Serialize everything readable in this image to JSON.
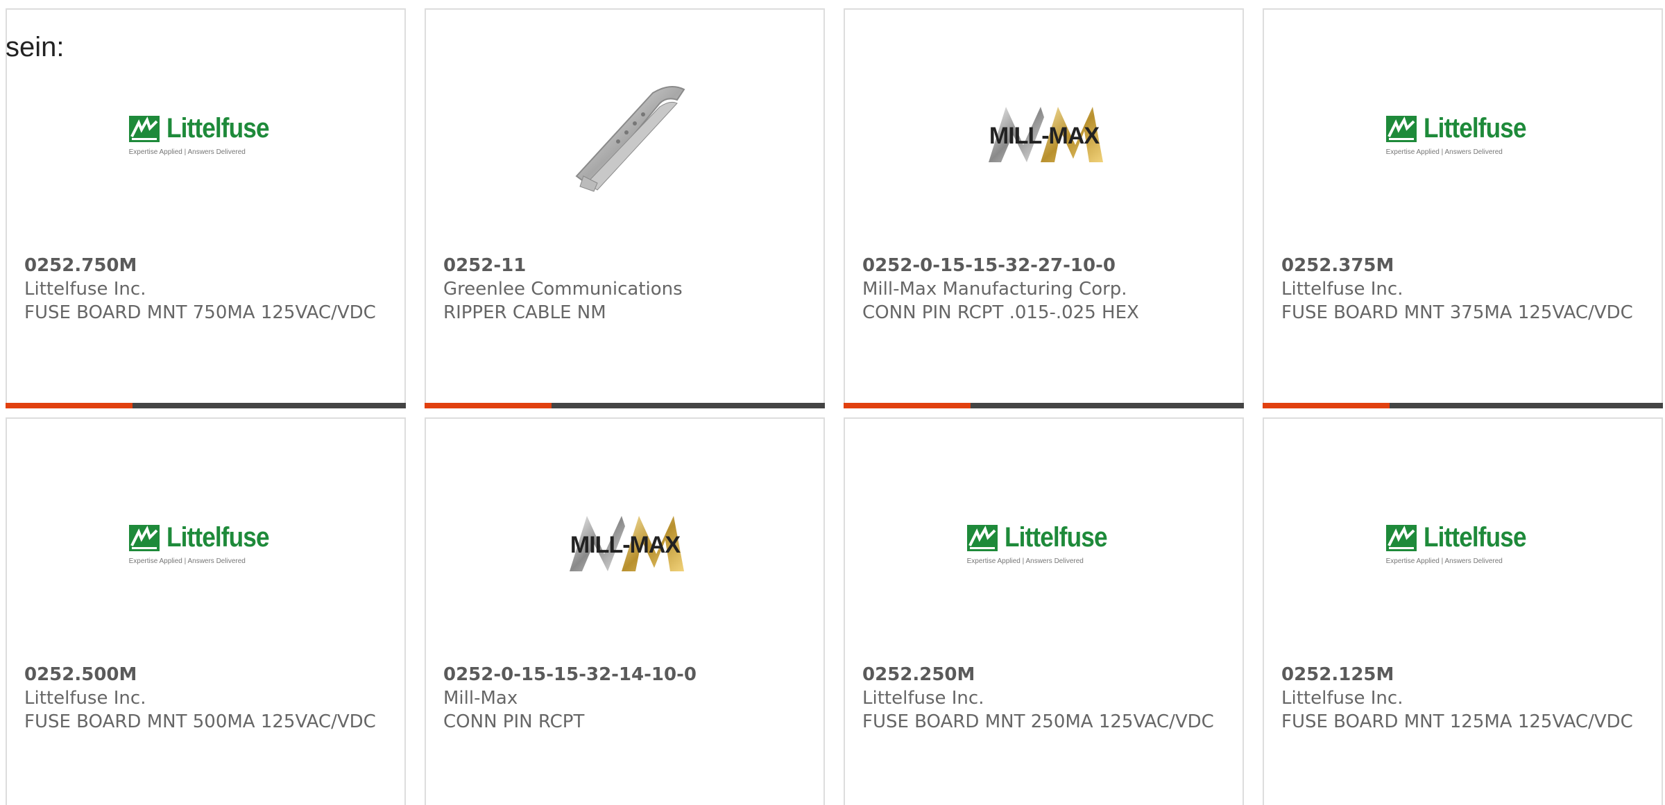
{
  "intro_text": "sein:",
  "colors": {
    "accent": "#e1400f",
    "bar": "#444444",
    "littelfuse_green": "#1e8a3a"
  },
  "logo_text": {
    "littelfuse_name": "Littelfuse",
    "littelfuse_tagline": "Expertise Applied | Answers Delivered",
    "millmax_name": "MILL-MAX"
  },
  "products": [
    {
      "part_number": "0252.750M",
      "manufacturer": "Littelfuse Inc.",
      "description": "FUSE BOARD MNT 750MA 125VAC/VDC",
      "image": "littelfuse-logo"
    },
    {
      "part_number": "0252-11",
      "manufacturer": "Greenlee Communications",
      "description": "RIPPER CABLE NM",
      "image": "cable-ripper-tool"
    },
    {
      "part_number": "0252-0-15-15-32-27-10-0",
      "manufacturer": "Mill-Max Manufacturing Corp.",
      "description": "CONN PIN RCPT .015-.025 HEX",
      "image": "millmax-logo"
    },
    {
      "part_number": "0252.375M",
      "manufacturer": "Littelfuse Inc.",
      "description": "FUSE BOARD MNT 375MA 125VAC/VDC",
      "image": "littelfuse-logo"
    },
    {
      "part_number": "0252.500M",
      "manufacturer": "Littelfuse Inc.",
      "description": "FUSE BOARD MNT 500MA 125VAC/VDC",
      "image": "littelfuse-logo"
    },
    {
      "part_number": "0252-0-15-15-32-14-10-0",
      "manufacturer": "Mill-Max",
      "description": "CONN PIN RCPT",
      "image": "millmax-logo"
    },
    {
      "part_number": "0252.250M",
      "manufacturer": "Littelfuse Inc.",
      "description": "FUSE BOARD MNT 250MA 125VAC/VDC",
      "image": "littelfuse-logo"
    },
    {
      "part_number": "0252.125M",
      "manufacturer": "Littelfuse Inc.",
      "description": "FUSE BOARD MNT 125MA 125VAC/VDC",
      "image": "littelfuse-logo"
    }
  ]
}
